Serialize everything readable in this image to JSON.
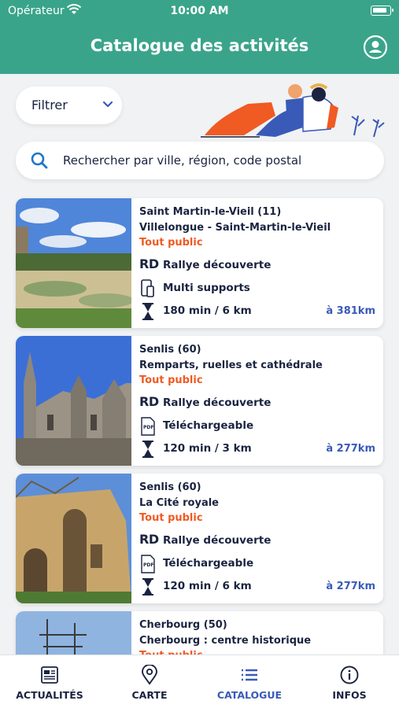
{
  "status_bar": {
    "carrier": "Opérateur",
    "time": "10:00 AM"
  },
  "header": {
    "title": "Catalogue des activités"
  },
  "filter": {
    "label": "Filtrer"
  },
  "search": {
    "placeholder": "Rechercher par ville, région, code postal"
  },
  "activities": [
    {
      "city": "Saint Martin-le-Vieil (11)",
      "route": "Villelongue - Saint-Martin-le-Vieil",
      "audience": "Tout public",
      "type": "Rallye découverte",
      "type_icon": "RD",
      "support": "Multi supports",
      "support_icon": "phone-icon",
      "duration": "180 min / 6 km",
      "distance": "à 381km"
    },
    {
      "city": "Senlis (60)",
      "route": "Remparts, ruelles et cathédrale",
      "audience": "Tout public",
      "type": "Rallye découverte",
      "type_icon": "RD",
      "support": "Téléchargeable",
      "support_icon": "pdf-icon",
      "duration": "120 min / 3 km",
      "distance": "à 277km"
    },
    {
      "city": "Senlis (60)",
      "route": "La Cité royale",
      "audience": "Tout public",
      "type": "Rallye découverte",
      "type_icon": "RD",
      "support": "Téléchargeable",
      "support_icon": "pdf-icon",
      "duration": "120 min / 6 km",
      "distance": "à 277km"
    },
    {
      "city": "Cherbourg (50)",
      "route": "Cherbourg : centre historique",
      "audience": "Tout public"
    }
  ],
  "tabs": [
    {
      "label": "Actualités",
      "icon": "news-icon",
      "active": false
    },
    {
      "label": "Carte",
      "icon": "map-pin-icon",
      "active": false
    },
    {
      "label": "Catalogue",
      "icon": "list-icon",
      "active": true
    },
    {
      "label": "Infos",
      "icon": "info-icon",
      "active": false
    }
  ],
  "colors": {
    "header": "#3aa48a",
    "accent_blue": "#3a5ab8",
    "audience_orange": "#f05a23",
    "text_dark": "#1a2340"
  }
}
